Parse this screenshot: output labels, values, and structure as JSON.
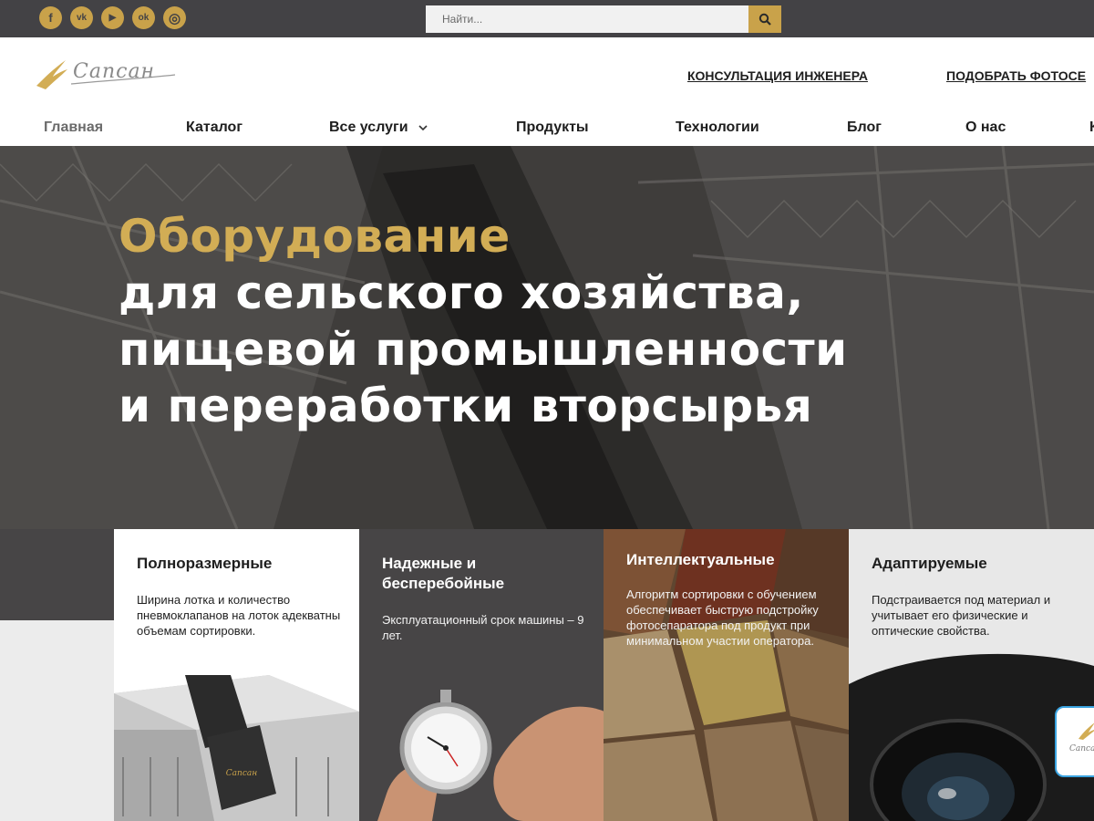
{
  "topbar": {
    "social": [
      {
        "icon": "facebook-icon",
        "glyph": "f"
      },
      {
        "icon": "vk-icon",
        "glyph": "vk"
      },
      {
        "icon": "youtube-icon",
        "glyph": "▶"
      },
      {
        "icon": "odnoklassniki-icon",
        "glyph": "ok"
      },
      {
        "icon": "instagram-icon",
        "glyph": "◎"
      }
    ],
    "search_placeholder": "Найти...",
    "search_icon": "search-icon"
  },
  "header": {
    "logo_text": "Сапсан",
    "link_engineer": "КОНСУЛЬТАЦИЯ ИНЖЕНЕРА",
    "link_pick": "ПОДОБРАТЬ ФОТОСЕ"
  },
  "nav": {
    "items": [
      "Главная",
      "Каталог",
      "Все услуги",
      "Продукты",
      "Технологии",
      "Блог",
      "О нас",
      "К"
    ]
  },
  "hero": {
    "line1": "Оборудование",
    "line2": "для сельского хозяйства,",
    "line3": "пищевой промышленности",
    "line4": "и переработки вторсырья"
  },
  "features": [
    {
      "title": "Полноразмерные",
      "text": "Ширина лотка и количество пневмоклапанов на лоток адекватны объемам сортировки."
    },
    {
      "title": "Надежные и бесперебойные",
      "text": "Эксплуатационный срок машины – 9 лет."
    },
    {
      "title": "Интеллектуальные",
      "text": "Алгоритм сортировки с обучением обеспечивает быструю подстройку фотосепаратора под продукт при минимальном участии оператора."
    },
    {
      "title": "Адаптируемые",
      "text": "Подстраивается под материал и учитывает его физические и оптические свойства."
    }
  ],
  "machine_brand": "Сапсан",
  "chat_badge_text": "Сапсан",
  "colors": {
    "accent": "#c9a24a",
    "topbar": "#434245",
    "dark_card": "#474546"
  }
}
